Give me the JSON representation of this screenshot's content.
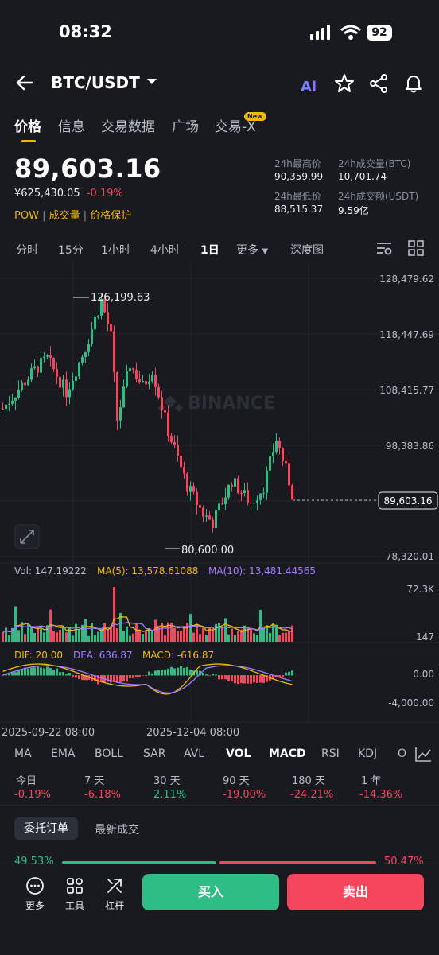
{
  "status_bar": {
    "time": "08:32",
    "battery": "92"
  },
  "header": {
    "pair": "BTC/USDT"
  },
  "tabs": [
    {
      "label": "价格",
      "active": true
    },
    {
      "label": "信息"
    },
    {
      "label": "交易数据"
    },
    {
      "label": "广场"
    },
    {
      "label": "交易-X",
      "badge": "New"
    }
  ],
  "ticker": {
    "last_price": "89,603.16",
    "cny_price": "¥625,430.05",
    "change_pct": "-0.19%",
    "tags": [
      "POW",
      "成交量",
      "价格保护"
    ],
    "high_label": "24h最高价",
    "high": "90,359.99",
    "low_label": "24h最低价",
    "low": "88,515.37",
    "vol_btc_label": "24h成交量(BTC)",
    "vol_btc": "10,701.74",
    "vol_usdt_label": "24h成交额(USDT)",
    "vol_usdt": "9.59亿"
  },
  "timeframes": [
    "分时",
    "15分",
    "1小时",
    "4小时",
    "1日",
    "更多",
    "深度图"
  ],
  "active_timeframe": "1日",
  "chart": {
    "price_ticks": [
      "128,479.62",
      "118,447.69",
      "108,415.77",
      "98,383.86",
      "78,320.01"
    ],
    "current_price_tag": "89,603.16",
    "max_label": "126,199.63",
    "min_label": "80,600.00",
    "watermark": "BINANCE",
    "vol_label": "Vol: 147.19222",
    "ma5_label": "MA(5): 13,578.61088",
    "ma10_label": "MA(10): 13,481.44565",
    "vol_ticks": [
      "72.3K",
      "147"
    ],
    "dif_label": "DIF: 20.00",
    "dea_label": "DEA: 636.87",
    "macd_label": "MACD: -616.87",
    "macd_ticks": [
      "0.00",
      "-4,000.00"
    ],
    "date_labels": [
      "2025-09-22 08:00",
      "2025-12-04 08:00"
    ]
  },
  "indicators": [
    "MA",
    "EMA",
    "BOLL",
    "SAR",
    "AVL",
    "VOL",
    "MACD",
    "RSI",
    "KDJ",
    "O"
  ],
  "performance": [
    {
      "label": "今日",
      "value": "-0.19%"
    },
    {
      "label": "7 天",
      "value": "-6.18%"
    },
    {
      "label": "30 天",
      "value": "2.11%"
    },
    {
      "label": "90 天",
      "value": "-19.00%"
    },
    {
      "label": "180 天",
      "value": "-24.21%"
    },
    {
      "label": "1 年",
      "value": "-14.36%"
    }
  ],
  "orderbook": {
    "tab1": "委托订单",
    "tab2": "最新成交",
    "buy_ratio": "49.53%",
    "sell_ratio": "50.47%"
  },
  "bottom": {
    "more": "更多",
    "tools": "工具",
    "leverage": "杠杆",
    "buy": "买入",
    "sell": "卖出"
  },
  "colors": {
    "up": "#2ebd85",
    "down": "#f6465d",
    "accent": "#f0b90b",
    "bg": "#181a20"
  }
}
